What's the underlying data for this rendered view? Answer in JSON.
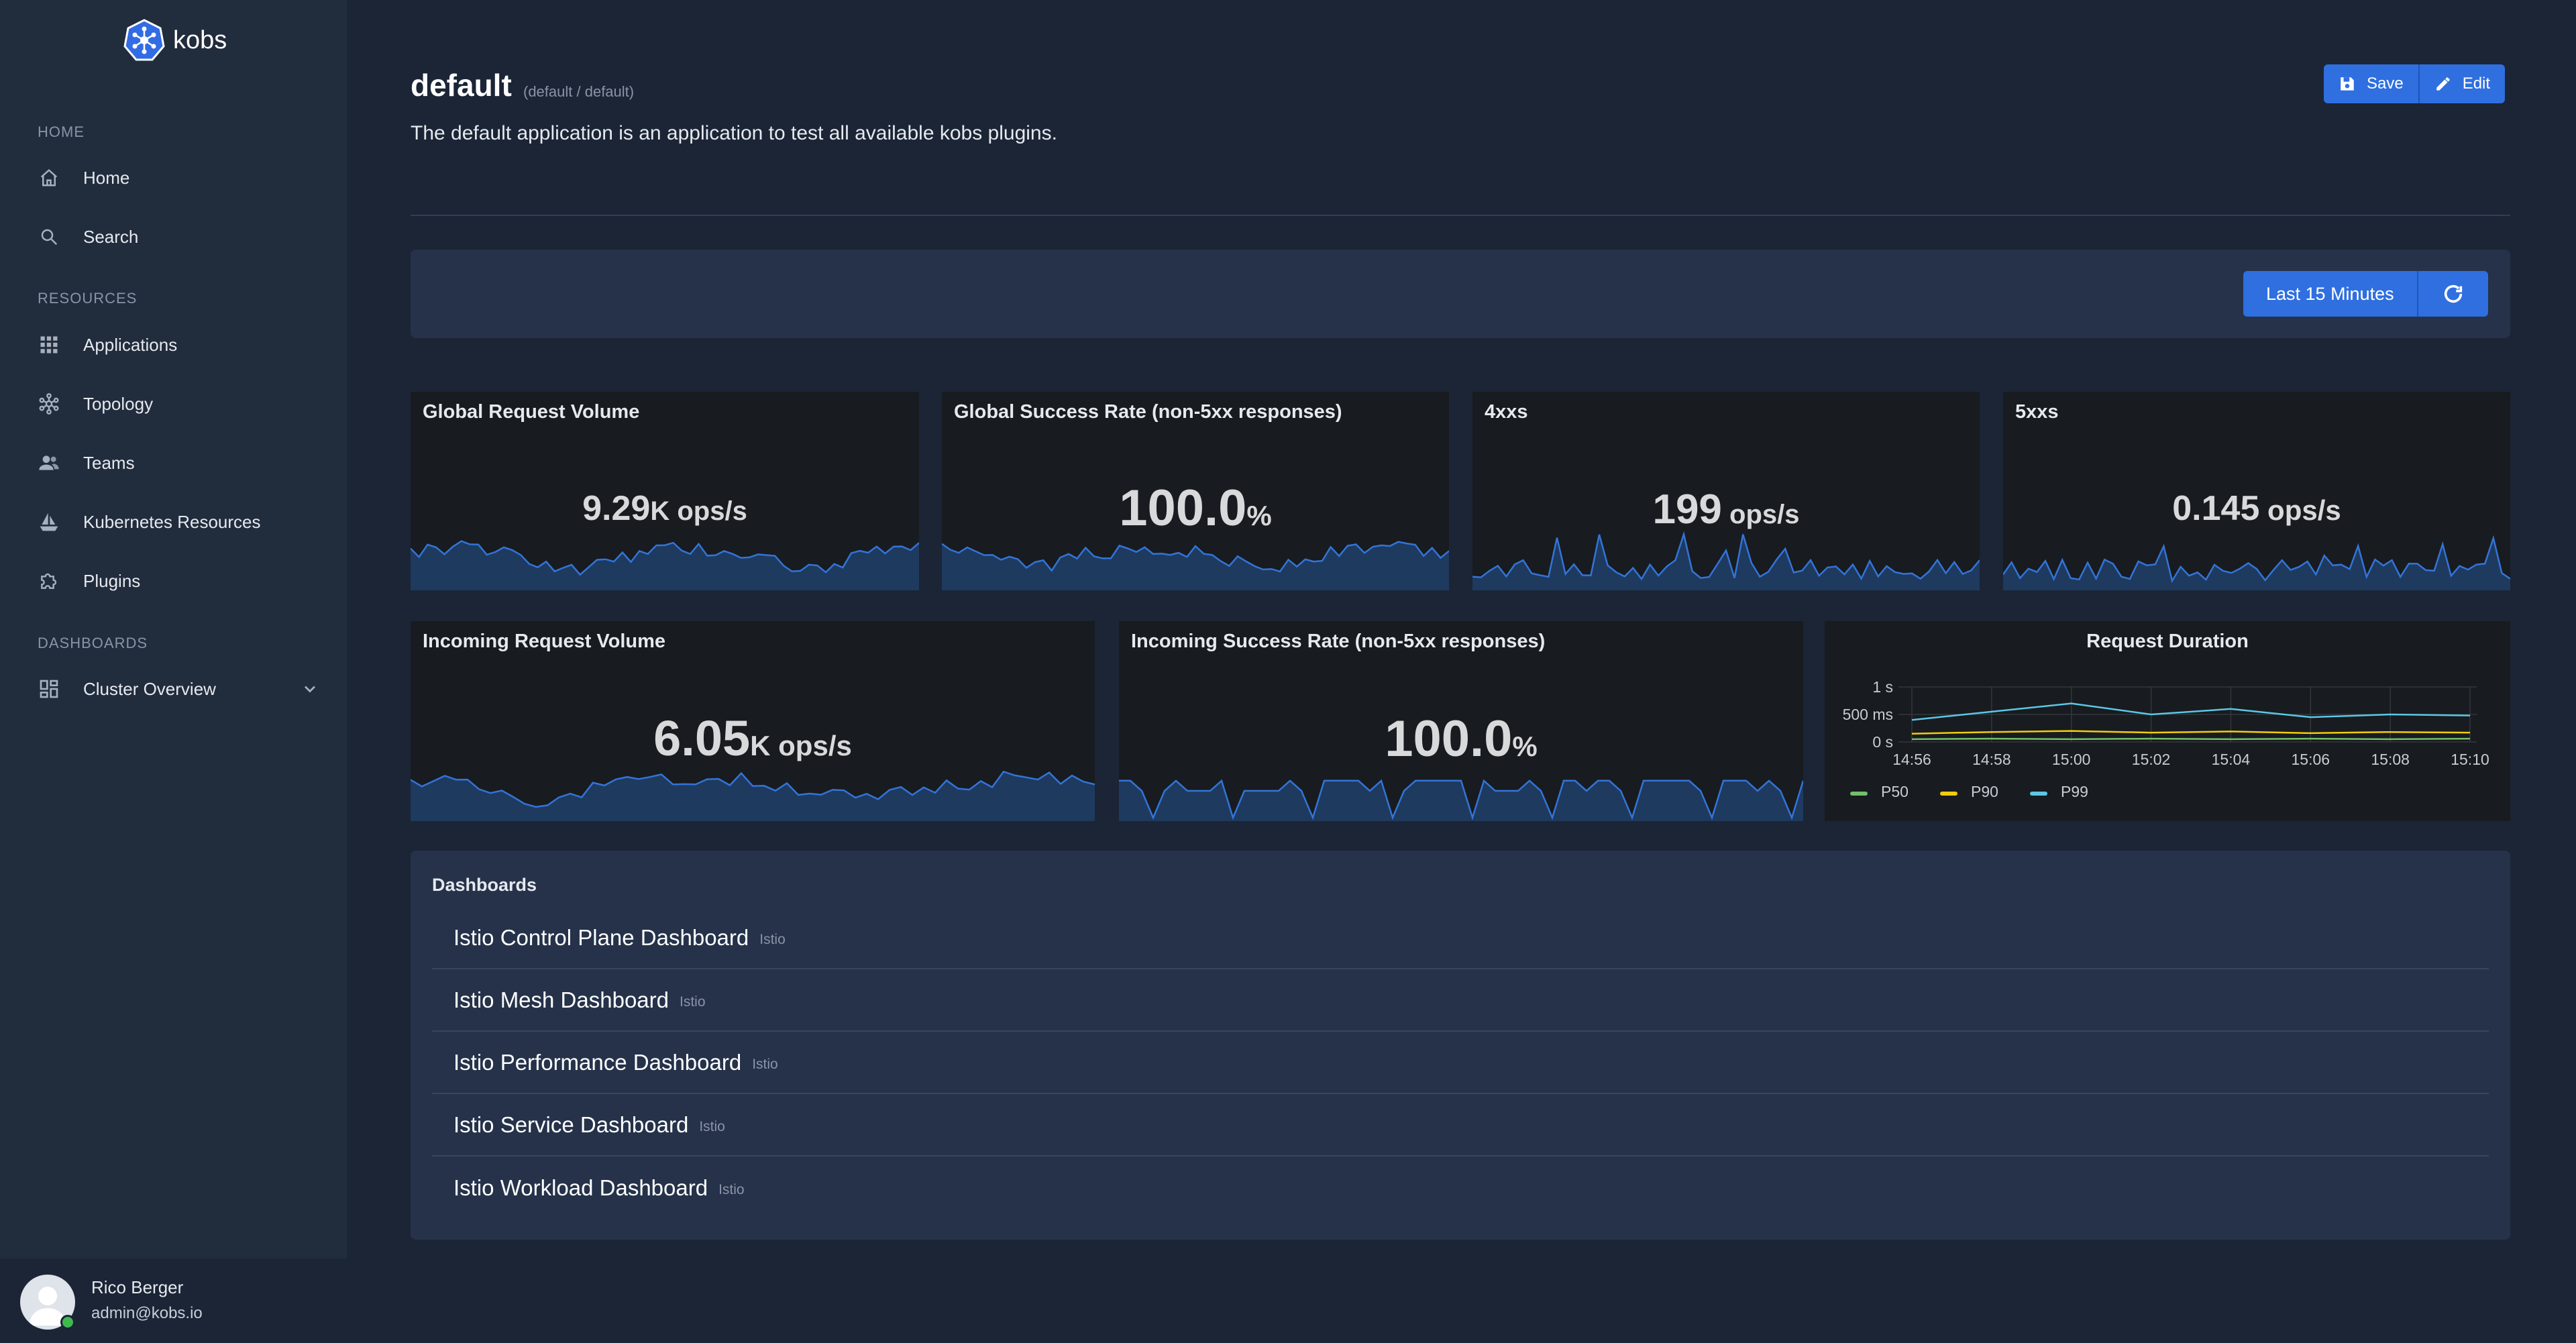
{
  "brand": {
    "name": "kobs"
  },
  "sidebar": {
    "sections": [
      "Home",
      "Resources",
      "Dashboards"
    ],
    "items": [
      {
        "label": "Home",
        "icon": "home-icon"
      },
      {
        "label": "Search",
        "icon": "search-icon"
      },
      {
        "label": "Applications",
        "icon": "grid-icon"
      },
      {
        "label": "Topology",
        "icon": "topology-icon"
      },
      {
        "label": "Teams",
        "icon": "users-icon"
      },
      {
        "label": "Kubernetes Resources",
        "icon": "ship-icon"
      },
      {
        "label": "Plugins",
        "icon": "puzzle-icon"
      },
      {
        "label": "Cluster Overview",
        "icon": "dashboard-icon"
      }
    ]
  },
  "user": {
    "name": "Rico Berger",
    "email": "admin@kobs.io",
    "status_color": "#3fb950"
  },
  "header": {
    "title": "default",
    "subtitle": "(default / default)",
    "description": "The default application is an application to test all available kobs plugins.",
    "save_label": "Save",
    "edit_label": "Edit"
  },
  "toolbar": {
    "time_range": "Last 15 Minutes"
  },
  "panels": {
    "global_request_volume": {
      "title": "Global Request Volume",
      "value": "9.29",
      "unit": "K ops/s"
    },
    "global_success_rate": {
      "title": "Global Success Rate (non-5xx responses)",
      "value": "100.0",
      "unit": "%"
    },
    "four_xx": {
      "title": "4xxs",
      "value": "199",
      "unit": "ops/s"
    },
    "five_xx": {
      "title": "5xxs",
      "value": "0.145",
      "unit": "ops/s"
    },
    "incoming_request_volume": {
      "title": "Incoming Request Volume",
      "value": "6.05",
      "unit": "K ops/s"
    },
    "incoming_success_rate": {
      "title": "Incoming Success Rate (non-5xx responses)",
      "value": "100.0",
      "unit": "%"
    }
  },
  "chart_data": {
    "type": "line",
    "title": "Request Duration",
    "x": [
      "14:56",
      "14:58",
      "15:00",
      "15:02",
      "15:04",
      "15:06",
      "15:08",
      "15:10"
    ],
    "y_ticks": [
      "0 s",
      "500 ms",
      "1 s"
    ],
    "ylim": [
      0,
      1
    ],
    "series": [
      {
        "name": "P50",
        "color": "#73bf69",
        "values": [
          0.05,
          0.06,
          0.05,
          0.06,
          0.05,
          0.06,
          0.05,
          0.06
        ]
      },
      {
        "name": "P90",
        "color": "#f2cc0c",
        "values": [
          0.15,
          0.18,
          0.2,
          0.17,
          0.19,
          0.16,
          0.18,
          0.17
        ]
      },
      {
        "name": "P99",
        "color": "#5ac8e6",
        "values": [
          0.4,
          0.55,
          0.7,
          0.5,
          0.6,
          0.45,
          0.5,
          0.48
        ]
      }
    ],
    "grid": true,
    "legend": "bottom-left"
  },
  "dashboards": {
    "title": "Dashboards",
    "items": [
      {
        "name": "Istio Control Plane Dashboard",
        "tag": "Istio"
      },
      {
        "name": "Istio Mesh Dashboard",
        "tag": "Istio"
      },
      {
        "name": "Istio Performance Dashboard",
        "tag": "Istio"
      },
      {
        "name": "Istio Service Dashboard",
        "tag": "Istio"
      },
      {
        "name": "Istio Workload Dashboard",
        "tag": "Istio"
      }
    ]
  },
  "colors": {
    "accent": "#2f6fe0",
    "spark_line": "#3274d9",
    "spark_fill": "#1f3a5f"
  }
}
